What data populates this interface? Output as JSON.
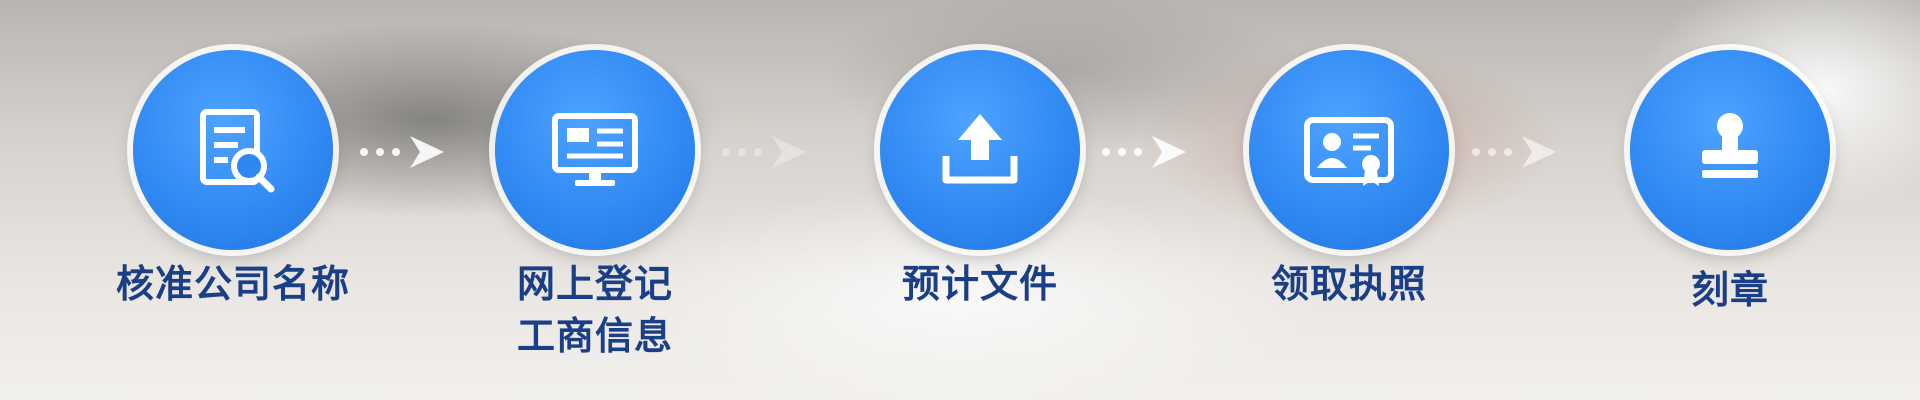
{
  "steps": [
    {
      "icon": "search-document-icon",
      "lines": [
        "核准公司名称"
      ]
    },
    {
      "icon": "monitor-icon",
      "lines": [
        "网上登记",
        "工商信息"
      ]
    },
    {
      "icon": "upload-icon",
      "lines": [
        "预计文件"
      ]
    },
    {
      "icon": "id-card-icon",
      "lines": [
        "领取执照"
      ]
    },
    {
      "icon": "stamp-icon",
      "lines": [
        "刻章"
      ]
    }
  ],
  "colors": {
    "circle": "#2f88f2",
    "label": "#1b3f86",
    "arrow": "#ffffff"
  }
}
